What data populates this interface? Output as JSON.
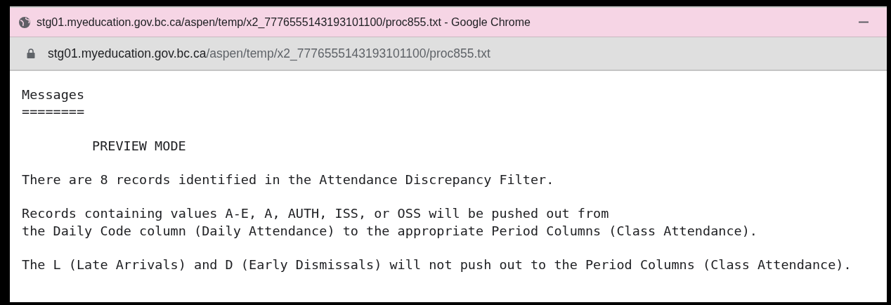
{
  "window": {
    "title": "stg01.myeducation.gov.bc.ca/aspen/temp/x2_7776555143193101100/proc855.txt - Google Chrome"
  },
  "address_bar": {
    "host": "stg01.myeducation.gov.bc.ca",
    "path": "/aspen/temp/x2_7776555143193101100/proc855.txt"
  },
  "document": {
    "heading": "Messages",
    "underline": "========",
    "blocks": [
      {
        "kind": "indented",
        "lines": [
          "PREVIEW MODE"
        ]
      },
      {
        "kind": "plain",
        "lines": [
          "There are 8 records identified in the Attendance Discrepancy Filter."
        ]
      },
      {
        "kind": "plain",
        "lines": [
          "Records containing values A-E, A, AUTH, ISS, or OSS will be pushed out from",
          "the Daily Code column (Daily Attendance) to the appropriate Period Columns (Class Attendance)."
        ]
      },
      {
        "kind": "plain",
        "lines": [
          "The L (Late Arrivals) and D (Early Dismissals) will not push out to the Period Columns (Class Attendance)."
        ]
      }
    ]
  }
}
